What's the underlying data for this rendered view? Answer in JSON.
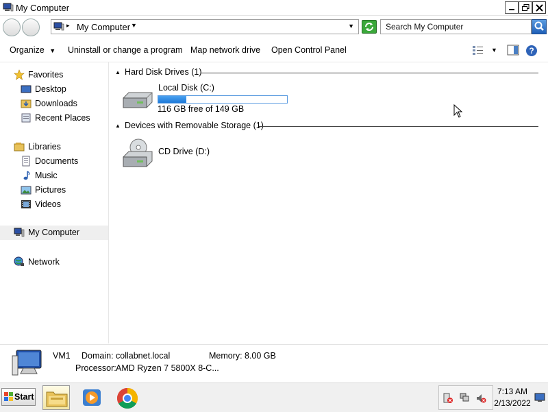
{
  "window": {
    "title": "My Computer"
  },
  "address": {
    "location": "My Computer",
    "search_placeholder": "Search My Computer"
  },
  "toolbar": {
    "organize": "Organize",
    "uninstall": "Uninstall or change a program",
    "map_drive": "Map network drive",
    "control_panel": "Open Control Panel"
  },
  "nav": {
    "favorites": "Favorites",
    "desktop": "Desktop",
    "downloads": "Downloads",
    "recent": "Recent Places",
    "libraries": "Libraries",
    "documents": "Documents",
    "music": "Music",
    "pictures": "Pictures",
    "videos": "Videos",
    "my_computer": "My Computer",
    "network": "Network"
  },
  "content": {
    "group_hdd": "Hard Disk Drives (1)",
    "group_removable": "Devices with Removable Storage (1)",
    "drives": [
      {
        "name": "Local Disk (C:)",
        "free_text": "116 GB free of 149 GB",
        "used_fraction": 0.22
      },
      {
        "name": "CD Drive (D:)"
      }
    ]
  },
  "details": {
    "computer_name": "VM1",
    "domain_label": "Domain:",
    "domain_value": "collabnet.local",
    "memory_label": "Memory:",
    "memory_value": "8.00 GB",
    "processor_label": "Processor:",
    "processor_value": "AMD Ryzen 7 5800X 8-C..."
  },
  "taskbar": {
    "start_label": "Start",
    "time": "7:13 AM",
    "date": "2/13/2022"
  },
  "colors": {
    "usage_fill": "#1e79d8",
    "selected_nav": "#efefef"
  }
}
